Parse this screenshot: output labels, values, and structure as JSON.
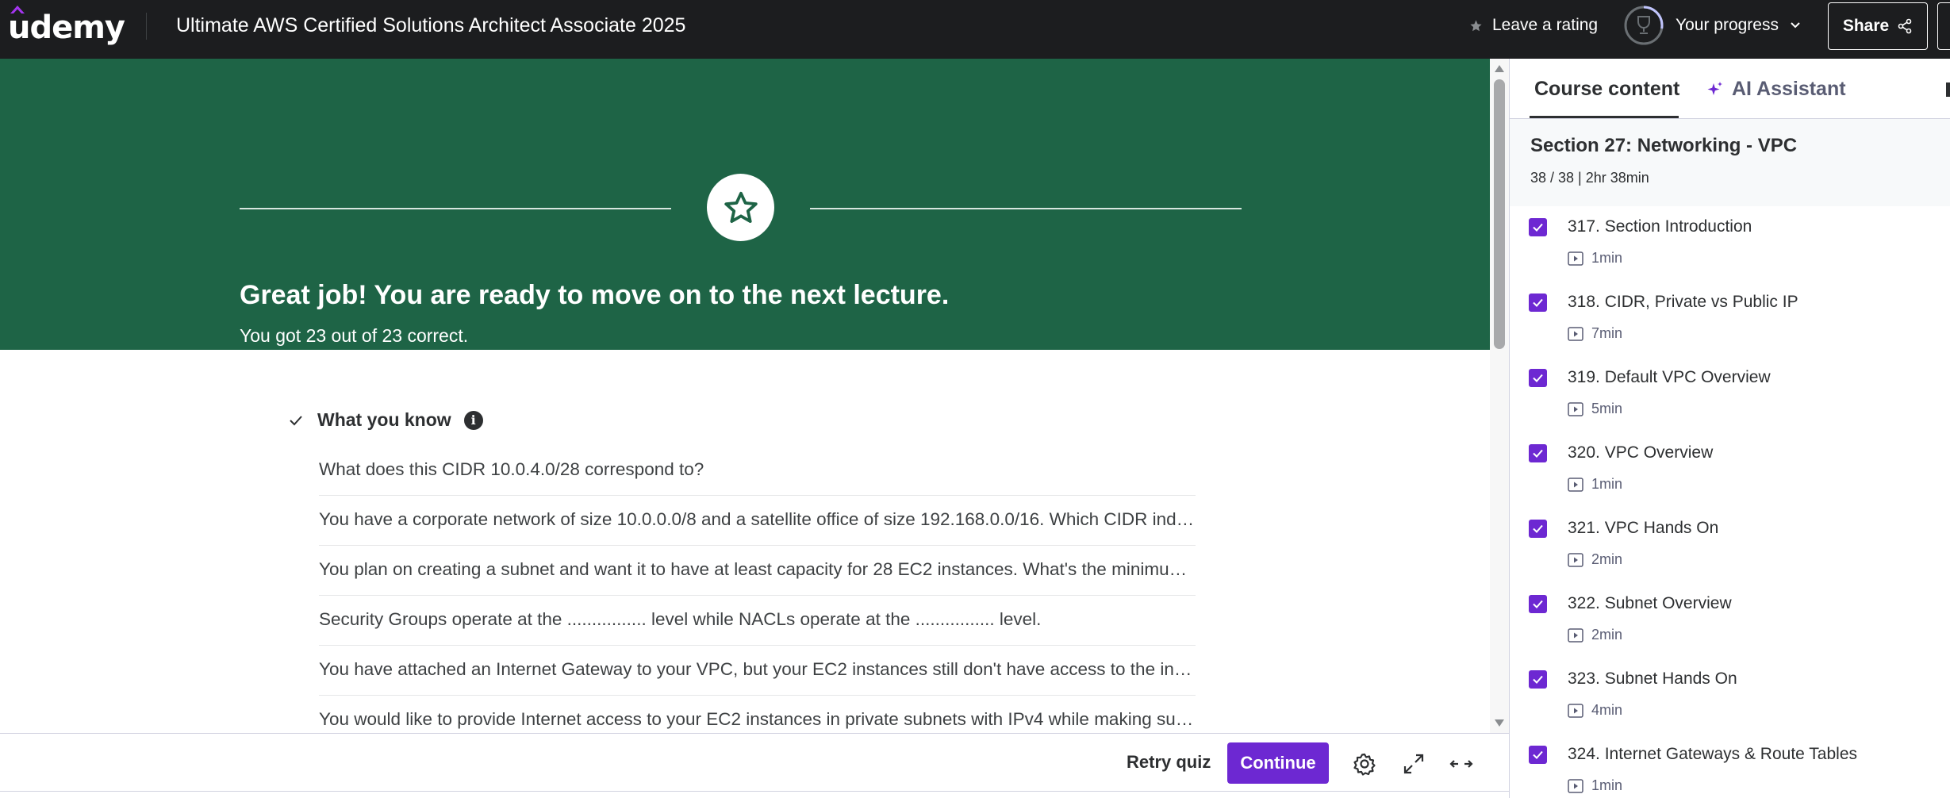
{
  "header": {
    "logo_text": "udemy",
    "course_title": "Ultimate AWS Certified Solutions Architect Associate 2025",
    "leave_rating": "Leave a rating",
    "your_progress": "Your progress",
    "share": "Share"
  },
  "banner": {
    "title": "Great job! You are ready to move on to the next lecture.",
    "subtitle": "You got 23 out of 23 correct."
  },
  "what_you_know": {
    "label": "What you know",
    "questions": [
      "What does this CIDR 10.0.4.0/28 correspond to?",
      "You have a corporate network of size 10.0.0.0/8 and a satellite office of size 192.168.0.0/16. Which CIDR independent range would you use for your VPC?",
      "You plan on creating a subnet and want it to have at least capacity for 28 EC2 instances. What's the minimum size you need to have for your subnet?",
      "Security Groups operate at the ................ level while NACLs operate at the ................ level.",
      "You have attached an Internet Gateway to your VPC, but your EC2 instances still don't have access to the internet. What is NOT a possible issue?",
      "You would like to provide Internet access to your EC2 instances in private subnets with IPv4 while making sure this solution requires the least amount of administration and scales seamlessly. What should you use?"
    ]
  },
  "footer": {
    "retry": "Retry quiz",
    "continue": "Continue"
  },
  "sidebar": {
    "tab_course_content": "Course content",
    "tab_ai_assistant": "AI Assistant",
    "section_title": "Section 27: Networking - VPC",
    "section_meta": "38 / 38 | 2hr 38min",
    "lectures": [
      {
        "name": "317. Section Introduction",
        "duration": "1min"
      },
      {
        "name": "318. CIDR, Private vs Public IP",
        "duration": "7min"
      },
      {
        "name": "319. Default VPC Overview",
        "duration": "5min"
      },
      {
        "name": "320. VPC Overview",
        "duration": "1min"
      },
      {
        "name": "321. VPC Hands On",
        "duration": "2min"
      },
      {
        "name": "322. Subnet Overview",
        "duration": "2min"
      },
      {
        "name": "323. Subnet Hands On",
        "duration": "4min"
      },
      {
        "name": "324. Internet Gateways & Route Tables",
        "duration": "1min"
      }
    ]
  },
  "colors": {
    "topbar": "#1c1d1f",
    "banner": "#1e6446",
    "accent_purple": "#6d28d2"
  }
}
